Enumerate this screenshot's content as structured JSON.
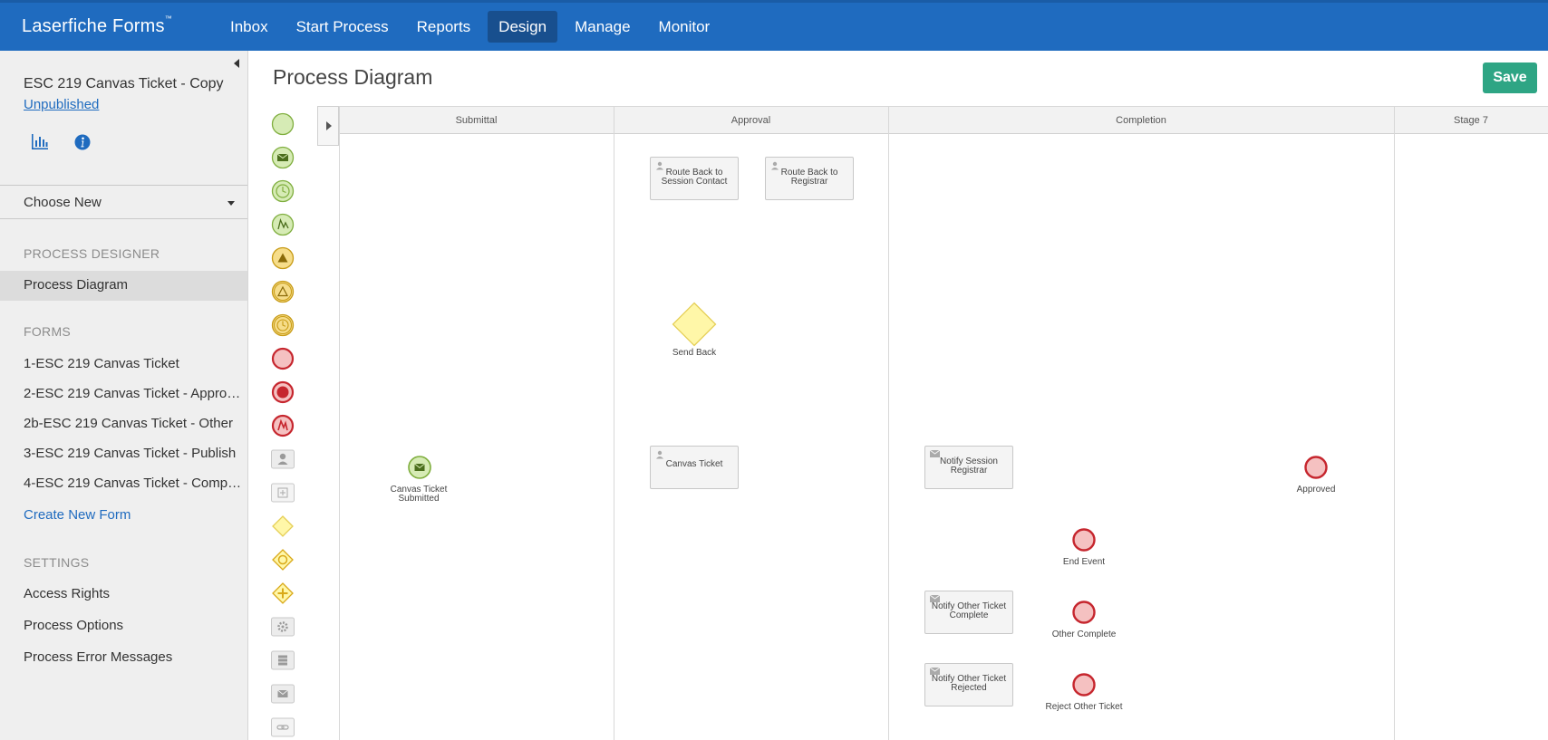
{
  "app": {
    "brand": "Laserfiche Forms",
    "trademark": "™",
    "nav": [
      "Inbox",
      "Start Process",
      "Reports",
      "Design",
      "Manage",
      "Monitor"
    ],
    "active_nav": "Design"
  },
  "sidebar": {
    "process_title": "ESC 219 Canvas Ticket - Copy",
    "status": "Unpublished",
    "choose_new": "Choose New",
    "process_designer_heading": "PROCESS DESIGNER",
    "process_diagram": "Process Diagram",
    "forms_heading": "FORMS",
    "forms": [
      "1-ESC 219 Canvas Ticket",
      "2-ESC 219 Canvas Ticket - Appro…",
      "2b-ESC 219 Canvas Ticket - Other",
      "3-ESC 219 Canvas Ticket - Publish",
      "4-ESC 219 Canvas Ticket - Comp…"
    ],
    "create_new_form": "Create New Form",
    "settings_heading": "SETTINGS",
    "settings": [
      "Access Rights",
      "Process Options",
      "Process Error Messages"
    ]
  },
  "main": {
    "title": "Process Diagram",
    "save_label": "Save"
  },
  "palette": [
    "start-event-icon",
    "message-start-event-icon",
    "timer-start-event-icon",
    "signal-start-event-icon",
    "escalation-event-icon",
    "intermediate-escalation-event-icon",
    "intermediate-timer-event-icon",
    "end-event-icon",
    "terminate-end-event-icon",
    "error-end-event-icon",
    "user-task-icon",
    "subprocess-icon",
    "exclusive-gateway-icon",
    "inclusive-gateway-icon",
    "parallel-gateway-icon",
    "service-task-icon",
    "script-task-icon",
    "email-task-icon",
    "link-icon"
  ],
  "diagram": {
    "lanes": [
      "Submittal",
      "Approval",
      "Completion",
      "Stage 7"
    ],
    "tasks": {
      "route_session_contact": "Route Back to Session Contact",
      "route_registrar": "Route Back to Registrar",
      "canvas_ticket": "Canvas Ticket",
      "notify_session_registrar": "Notify Session Registrar",
      "notify_other_complete": "Notify Other Ticket Complete",
      "notify_other_rejected": "Notify Other Ticket Rejected"
    },
    "events": {
      "start": "Canvas Ticket Submitted",
      "approved": "Approved",
      "end_event": "End Event",
      "other_complete": "Other Complete",
      "reject_other": "Reject Other Ticket"
    },
    "gateway": "Send Back",
    "colors": {
      "start_fill": "#d6ebb5",
      "start_stroke": "#7fae3e",
      "end_fill": "#f5c1c1",
      "end_stroke": "#c6262e",
      "gateway_fill": "#fff7a8",
      "gateway_stroke": "#e5cf57"
    }
  }
}
